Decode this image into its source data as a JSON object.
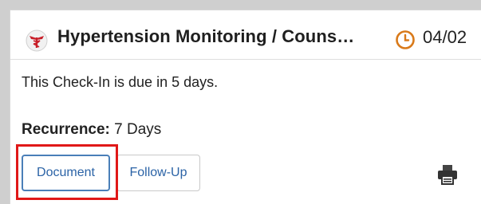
{
  "card": {
    "title": "Hypertension Monitoring / Couns…",
    "date": "04/02",
    "header_icon": "caduceus-icon",
    "clock_icon": "clock-icon",
    "due_text": "This Check-In is due in 5 days.",
    "recurrence_label": "Recurrence:",
    "recurrence_value": "7 Days"
  },
  "actions": {
    "document_label": "Document",
    "followup_label": "Follow-Up",
    "print_icon": "printer-icon"
  },
  "colors": {
    "accent_text": "#2b63a6",
    "highlight": "#e01818",
    "clock": "#d97a1a",
    "header_icon_red": "#c8202a"
  }
}
